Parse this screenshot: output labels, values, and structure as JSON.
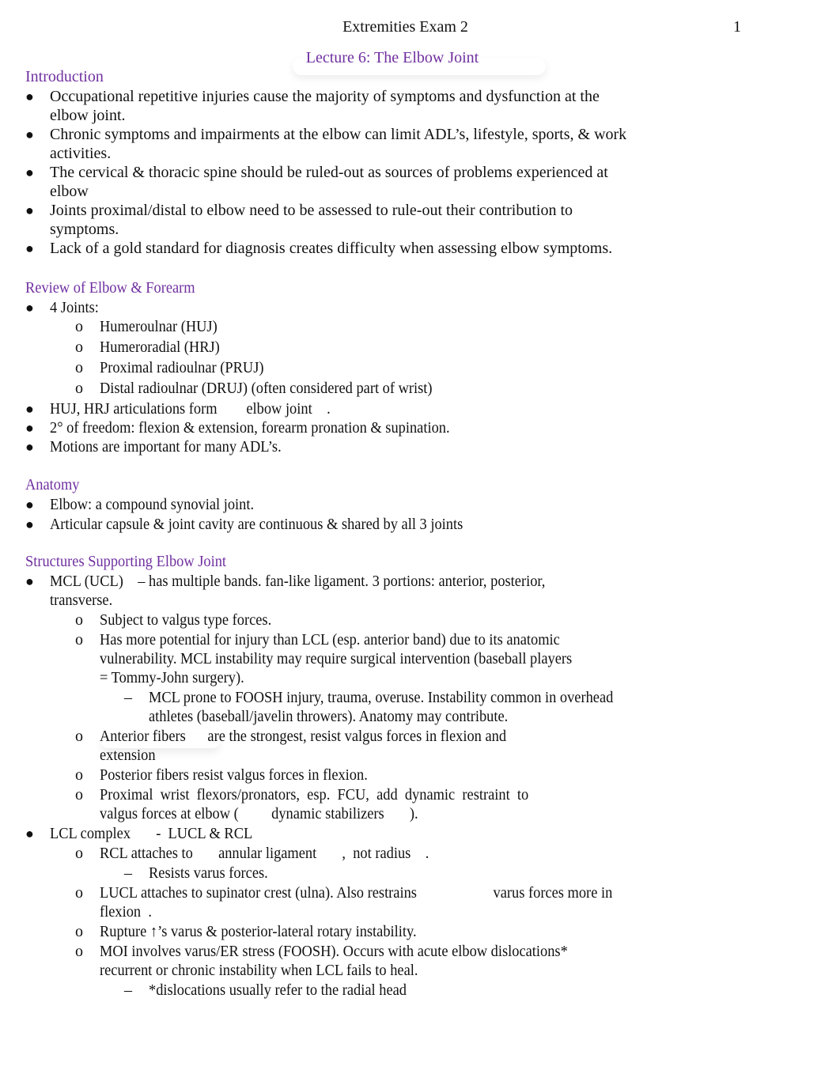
{
  "header": {
    "title": "Extremities Exam 2",
    "page_number": "1",
    "lecture_title": "Lecture 6: The Elbow Joint"
  },
  "colors": {
    "heading": "#7030a0",
    "text": "#111111"
  },
  "sections": {
    "introduction": {
      "title": "Introduction",
      "items": [
        {
          "marker": "●",
          "lines": [
            "Occupational repetitive injuries cause the majority of symptoms and dysfunction at the",
            "elbow joint."
          ]
        },
        {
          "marker": "●",
          "lines": [
            "Chronic symptoms and impairments at the elbow can limit ADL’s, lifestyle, sports, & work",
            "activities."
          ]
        },
        {
          "marker": "●",
          "lines": [
            "The cervical & thoracic spine should be ruled-out as sources of problems experienced at",
            "elbow"
          ]
        },
        {
          "marker": "●",
          "lines": [
            "Joints proximal/distal to elbow need to be assessed to rule-out their contribution to",
            "symptoms."
          ]
        },
        {
          "marker": "●",
          "lines": [
            "Lack of a gold standard for diagnosis creates difficulty when assessing elbow symptoms."
          ]
        }
      ]
    },
    "review": {
      "title": "Review of Elbow & Forearm",
      "items": [
        {
          "level": 1,
          "marker": "●",
          "text": "4 Joints:"
        },
        {
          "level": 2,
          "marker": "o",
          "text": "Humeroulnar (HUJ)"
        },
        {
          "level": 2,
          "marker": "o",
          "text": "Humeroradial (HRJ)"
        },
        {
          "level": 2,
          "marker": "o",
          "text": "Proximal radioulnar (PRUJ)"
        },
        {
          "level": 2,
          "marker": "o",
          "text": "Distal radioulnar (DRUJ) (often considered part of wrist)"
        },
        {
          "level": 1,
          "marker": "●",
          "text": "HUJ, HRJ articulations form        elbow joint    ."
        },
        {
          "level": 1,
          "marker": "●",
          "text": "2° of freedom: flexion & extension, forearm pronation & supination."
        },
        {
          "level": 1,
          "marker": "●",
          "text": "Motions are important for many ADL’s."
        }
      ]
    },
    "anatomy": {
      "title": "Anatomy",
      "items": [
        {
          "level": 1,
          "marker": "●",
          "text": "Elbow: a compound synovial joint."
        },
        {
          "level": 1,
          "marker": "●",
          "text": "Articular capsule & joint cavity are continuous & shared by all 3 joints"
        }
      ]
    },
    "structures": {
      "title": "Structures Supporting Elbow Joint",
      "items": [
        {
          "level": 1,
          "marker": "●",
          "lines": [
            "MCL (UCL)    – has multiple bands. fan-like ligament. 3 portions: anterior, posterior,",
            "transverse."
          ]
        },
        {
          "level": 2,
          "marker": "o",
          "lines": [
            "Subject to valgus type forces."
          ]
        },
        {
          "level": 2,
          "marker": "o",
          "lines": [
            "Has more potential for injury than LCL (esp. anterior band) due to its anatomic",
            "vulnerability. MCL instability may require surgical intervention (baseball players",
            "= Tommy-John surgery)."
          ]
        },
        {
          "level": 3,
          "marker": "–",
          "lines": [
            "MCL prone to FOOSH injury, trauma, overuse. Instability common in overhead",
            "athletes (baseball/javelin throwers). Anatomy may contribute."
          ]
        },
        {
          "level": 2,
          "marker": "o",
          "lines": [
            "Anterior fibers      are the strongest, resist valgus forces in flexion and",
            "extension"
          ]
        },
        {
          "level": 2,
          "marker": "o",
          "lines": [
            "Posterior fibers resist valgus forces in flexion."
          ]
        },
        {
          "level": 2,
          "marker": "o",
          "lines": [
            "Proximal  wrist  flexors/pronators,  esp.  FCU,  add  dynamic  restraint  to",
            "valgus forces at elbow (         dynamic stabilizers       )."
          ]
        },
        {
          "level": 1,
          "marker": "●",
          "lines": [
            "LCL complex       -  LUCL & RCL"
          ]
        },
        {
          "level": 2,
          "marker": "o",
          "lines": [
            "RCL attaches to       annular ligament       ,  not radius    ."
          ]
        },
        {
          "level": 3,
          "marker": "–",
          "lines": [
            "Resists varus forces."
          ]
        },
        {
          "level": 2,
          "marker": "o",
          "lines": [
            "LUCL attaches to supinator crest (ulna). Also restrains                     varus forces more in",
            "flexion  ."
          ]
        },
        {
          "level": 2,
          "marker": "o",
          "lines": [
            "Rupture ↑’s varus & posterior-lateral rotary instability."
          ]
        },
        {
          "level": 2,
          "marker": "o",
          "lines": [
            "MOI involves varus/ER stress (FOOSH). Occurs with acute elbow dislocations*",
            "recurrent or chronic instability when LCL fails to heal."
          ]
        },
        {
          "level": 3,
          "marker": "–",
          "lines": [
            "*dislocations usually refer to the radial head"
          ]
        }
      ]
    }
  }
}
